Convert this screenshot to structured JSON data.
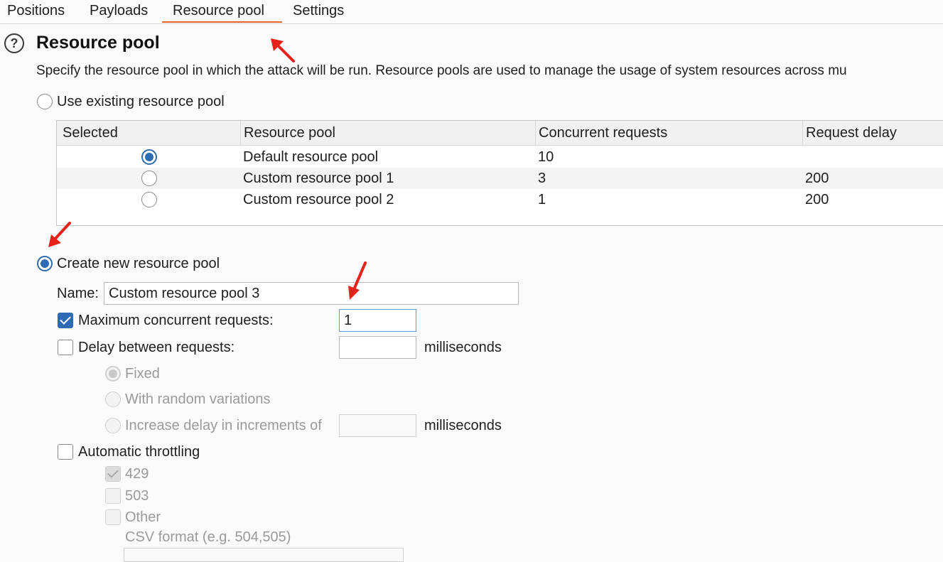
{
  "tabs": [
    {
      "label": "Positions"
    },
    {
      "label": "Payloads"
    },
    {
      "label": "Resource pool"
    },
    {
      "label": "Settings"
    }
  ],
  "active_tab": "Resource pool",
  "accent_color": "#e8632a",
  "selection_color": "#2f6bb3",
  "section": {
    "title": "Resource pool",
    "description": "Specify the resource pool in which the attack will be run. Resource pools are used to manage the usage of system resources across mu"
  },
  "use_existing": {
    "label": "Use existing resource pool",
    "selected": false
  },
  "table": {
    "headers": [
      "Selected",
      "Resource pool",
      "Concurrent requests",
      "Request delay"
    ],
    "rows": [
      {
        "selected": true,
        "name": "Default resource pool",
        "concurrent": "10",
        "delay": ""
      },
      {
        "selected": false,
        "name": "Custom resource pool 1",
        "concurrent": "3",
        "delay": "200"
      },
      {
        "selected": false,
        "name": "Custom resource pool 2",
        "concurrent": "1",
        "delay": "200"
      }
    ]
  },
  "create_new": {
    "label": "Create new resource pool",
    "selected": true
  },
  "form": {
    "name_label": "Name:",
    "name_value": "Custom resource pool 3",
    "max_concurrent": {
      "label": "Maximum concurrent requests:",
      "checked": true,
      "value": "1"
    },
    "delay": {
      "label": "Delay between requests:",
      "checked": false,
      "value": "",
      "unit": "milliseconds"
    },
    "delay_options": {
      "fixed": {
        "label": "Fixed",
        "selected": true
      },
      "random": {
        "label": "With random variations",
        "selected": false
      },
      "increase": {
        "label": "Increase delay in increments of",
        "selected": false,
        "value": "",
        "unit": "milliseconds"
      }
    },
    "throttling": {
      "label": "Automatic throttling",
      "checked": false,
      "codes": [
        {
          "label": "429",
          "checked": true
        },
        {
          "label": "503",
          "checked": false
        },
        {
          "label": "Other",
          "checked": false
        }
      ],
      "csv_label": "CSV format (e.g. 504,505)"
    }
  }
}
